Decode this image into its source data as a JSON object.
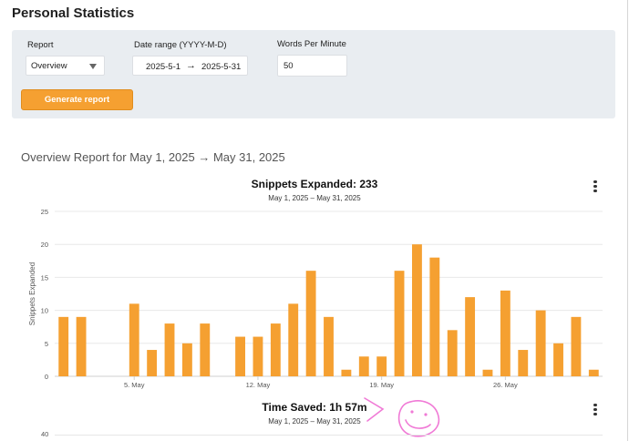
{
  "page": {
    "title": "Personal Statistics"
  },
  "form": {
    "report": {
      "label": "Report",
      "value": "Overview"
    },
    "date_range": {
      "label": "Date range (YYYY-M-D)",
      "start": "2025-5-1",
      "arrow": "→",
      "end": "2025-5-31"
    },
    "wpm": {
      "label": "Words Per Minute",
      "value": "50"
    },
    "generate_label": "Generate report"
  },
  "report_heading": "Overview Report for May 1, 2025 → May 31, 2025",
  "charts": {
    "snippets": {
      "title": "Snippets Expanded: 233",
      "subtitle": "May 1, 2025 – May 31, 2025"
    },
    "time_saved": {
      "title": "Time Saved: 1h 57m",
      "subtitle": "May 1, 2025 – May 31, 2025",
      "first_tick": "40"
    }
  },
  "colors": {
    "bar": "#f5a031",
    "annotation": "#f07ad6",
    "button": "#f5a031"
  },
  "icons": {
    "menu": "kebab-menu-icon",
    "report_caret": "chevron-down-icon"
  },
  "chart_data": {
    "type": "bar",
    "title": "Snippets Expanded: 233",
    "subtitle": "May 1, 2025 – May 31, 2025",
    "ylabel": "Snippets Expanded",
    "xlabel": "",
    "ylim": [
      0,
      25
    ],
    "yticks": [
      0,
      5,
      10,
      15,
      20,
      25
    ],
    "xtick_labels": [
      {
        "label": "5. May",
        "day": 5
      },
      {
        "label": "12. May",
        "day": 12
      },
      {
        "label": "19. May",
        "day": 19
      },
      {
        "label": "26. May",
        "day": 26
      }
    ],
    "days": [
      1,
      2,
      3,
      4,
      5,
      6,
      7,
      8,
      9,
      10,
      11,
      12,
      13,
      14,
      15,
      16,
      17,
      18,
      19,
      20,
      21,
      22,
      23,
      24,
      25,
      26,
      27,
      28,
      29,
      30,
      31
    ],
    "values": [
      9,
      9,
      0,
      0,
      11,
      4,
      8,
      5,
      8,
      0,
      6,
      6,
      8,
      11,
      16,
      9,
      1,
      3,
      3,
      16,
      20,
      18,
      7,
      12,
      1,
      13,
      4,
      10,
      5,
      9,
      1
    ],
    "grid": true,
    "legend": "none"
  }
}
